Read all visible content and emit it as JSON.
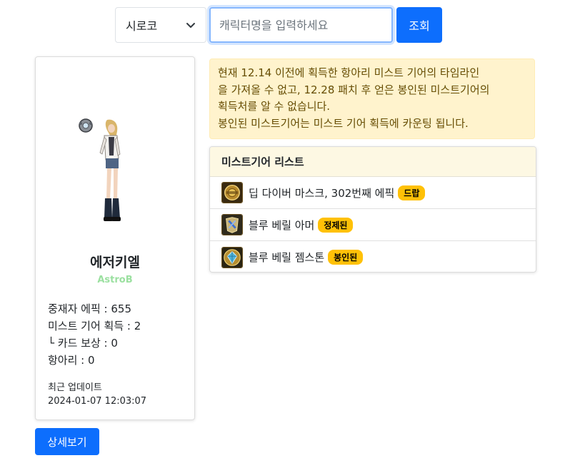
{
  "search": {
    "server_selected": "시로코",
    "name_placeholder": "캐릭터명을 입력하세요",
    "submit_label": "조회"
  },
  "character": {
    "name": "에저키엘",
    "guild": "AstroB",
    "stats": [
      "중재자 에픽 : 655",
      "미스트 기어 획득 : 2",
      "└ 카드 보상 : 0",
      "항아리 : 0"
    ],
    "update_label": "최근 업데이트",
    "update_time": "2024-01-07 12:03:07",
    "detail_button": "상세보기"
  },
  "notice": {
    "lines": [
      "현재 12.14 이전에 획득한 항아리 미스트 기어의 타임라인",
      "을 가져올 수 없고, 12.28 패치 후 얻은 봉인된 미스트기어의",
      "획득처를 알 수 없습니다.",
      "봉인된 미스트기어는 미스트 기어 획득에 카운팅 됩니다."
    ]
  },
  "gear_list": {
    "title": "미스트기어 리스트",
    "items": [
      {
        "name": "딥 다이버 마스크, 302번째 에픽",
        "badge": "드랍",
        "icon": "mask-icon"
      },
      {
        "name": "블루 베릴 아머",
        "badge": "정제된",
        "icon": "armor-icon"
      },
      {
        "name": "블루 베릴 젬스톤",
        "badge": "봉인된",
        "icon": "gemstone-icon"
      }
    ]
  },
  "colors": {
    "primary": "#0d6efd",
    "badge": "#ffc107",
    "notice_bg": "#fff3cd",
    "notice_text": "#664d03",
    "guild": "#9be0a0"
  }
}
